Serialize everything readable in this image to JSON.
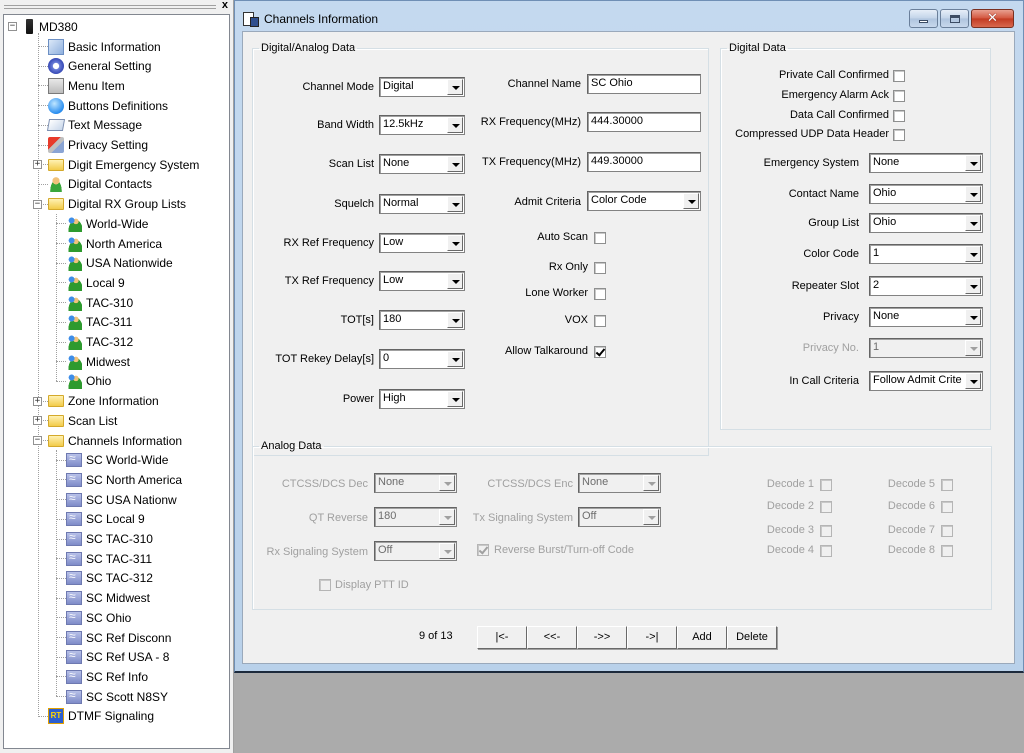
{
  "tree": {
    "close_label": "x",
    "root": {
      "label": "MD380",
      "icon": "radio-icon",
      "expanded": true
    },
    "items": [
      {
        "label": "Basic Information",
        "icon": "document-icon",
        "level": 1
      },
      {
        "label": "General Setting",
        "icon": "gear-icon",
        "level": 1
      },
      {
        "label": "Menu Item",
        "icon": "menu-icon",
        "level": 1
      },
      {
        "label": "Buttons Definitions",
        "icon": "button-icon",
        "level": 1
      },
      {
        "label": "Text Message",
        "icon": "message-icon",
        "level": 1
      },
      {
        "label": "Privacy Setting",
        "icon": "privacy-icon",
        "level": 1
      },
      {
        "label": "Digit Emergency System",
        "icon": "folder-icon",
        "level": 1,
        "expander": "+"
      },
      {
        "label": "Digital Contacts",
        "icon": "contact-icon",
        "level": 1
      },
      {
        "label": "Digital RX Group Lists",
        "icon": "folder-open-icon",
        "level": 1,
        "expander": "-"
      },
      {
        "label": "World-Wide",
        "icon": "group-icon",
        "level": 2
      },
      {
        "label": "North America",
        "icon": "group-icon",
        "level": 2
      },
      {
        "label": "USA Nationwide",
        "icon": "group-icon",
        "level": 2
      },
      {
        "label": "Local 9",
        "icon": "group-icon",
        "level": 2
      },
      {
        "label": "TAC-310",
        "icon": "group-icon",
        "level": 2
      },
      {
        "label": "TAC-311",
        "icon": "group-icon",
        "level": 2
      },
      {
        "label": "TAC-312",
        "icon": "group-icon",
        "level": 2
      },
      {
        "label": "Midwest",
        "icon": "group-icon",
        "level": 2
      },
      {
        "label": "Ohio",
        "icon": "group-icon",
        "level": 2
      },
      {
        "label": "Zone Information",
        "icon": "folder-icon",
        "level": 1,
        "expander": "+"
      },
      {
        "label": "Scan List",
        "icon": "folder-icon",
        "level": 1,
        "expander": "+"
      },
      {
        "label": "Channels Information",
        "icon": "folder-open-icon",
        "level": 1,
        "expander": "-"
      },
      {
        "label": "SC World-Wide",
        "icon": "channel-icon",
        "level": 2
      },
      {
        "label": "SC North America",
        "icon": "channel-icon",
        "level": 2
      },
      {
        "label": "SC USA Nationw",
        "icon": "channel-icon",
        "level": 2
      },
      {
        "label": "SC Local 9",
        "icon": "channel-icon",
        "level": 2
      },
      {
        "label": "SC TAC-310",
        "icon": "channel-icon",
        "level": 2
      },
      {
        "label": "SC TAC-311",
        "icon": "channel-icon",
        "level": 2
      },
      {
        "label": "SC TAC-312",
        "icon": "channel-icon",
        "level": 2
      },
      {
        "label": "SC Midwest",
        "icon": "channel-icon",
        "level": 2
      },
      {
        "label": "SC Ohio",
        "icon": "channel-icon",
        "level": 2
      },
      {
        "label": "SC Ref Disconn",
        "icon": "channel-icon",
        "level": 2
      },
      {
        "label": "SC Ref USA - 8",
        "icon": "channel-icon",
        "level": 2
      },
      {
        "label": "SC Ref Info",
        "icon": "channel-icon",
        "level": 2
      },
      {
        "label": "SC Scott N8SY",
        "icon": "channel-icon",
        "level": 2
      },
      {
        "label": "DTMF Signaling",
        "icon": "dtmf-icon",
        "level": 1
      }
    ]
  },
  "window": {
    "title": "Channels Information",
    "buttons": {
      "minimize": "minimize",
      "maximize": "maximize",
      "close": "close"
    }
  },
  "digital_analog": {
    "legend": "Digital/Analog Data",
    "left_fields": [
      {
        "label": "Channel Mode",
        "value": "Digital"
      },
      {
        "label": "Band Width",
        "value": "12.5kHz"
      },
      {
        "label": "Scan List",
        "value": "None"
      },
      {
        "label": "Squelch",
        "value": "Normal"
      },
      {
        "label": "RX Ref Frequency",
        "value": "Low"
      },
      {
        "label": "TX Ref Frequency",
        "value": "Low"
      },
      {
        "label": "TOT[s]",
        "value": "180"
      },
      {
        "label": "TOT Rekey Delay[s]",
        "value": "0"
      },
      {
        "label": "Power",
        "value": "High"
      }
    ],
    "channel_name": {
      "label": "Channel Name",
      "value": "SC Ohio"
    },
    "rx_freq": {
      "label": "RX Frequency(MHz)",
      "value": "444.30000"
    },
    "tx_freq": {
      "label": "TX Frequency(MHz)",
      "value": "449.30000"
    },
    "admit_criteria": {
      "label": "Admit Criteria",
      "value": "Color Code"
    },
    "checks": [
      {
        "label": "Auto Scan",
        "checked": false
      },
      {
        "label": "Rx Only",
        "checked": false
      },
      {
        "label": "Lone Worker",
        "checked": false
      },
      {
        "label": "VOX",
        "checked": false
      },
      {
        "label": "Allow Talkaround",
        "checked": true
      }
    ]
  },
  "digital": {
    "legend": "Digital Data",
    "checks": [
      {
        "label": "Private Call Confirmed",
        "checked": false
      },
      {
        "label": "Emergency Alarm Ack",
        "checked": false
      },
      {
        "label": "Data Call Confirmed",
        "checked": false
      },
      {
        "label": "Compressed UDP Data Header",
        "checked": false
      }
    ],
    "fields": [
      {
        "label": "Emergency System",
        "value": "None",
        "disabled": false
      },
      {
        "label": "Contact Name",
        "value": "Ohio",
        "disabled": false
      },
      {
        "label": "Group List",
        "value": "Ohio",
        "disabled": false
      },
      {
        "label": "Color Code",
        "value": "1",
        "disabled": false
      },
      {
        "label": "Repeater Slot",
        "value": "2",
        "disabled": false
      },
      {
        "label": "Privacy",
        "value": "None",
        "disabled": false
      },
      {
        "label": "Privacy No.",
        "value": "1",
        "disabled": true
      },
      {
        "label": "In Call Criteria",
        "value": "Follow Admit Criteria",
        "disabled": false
      }
    ]
  },
  "analog": {
    "legend": "Analog Data",
    "ctcss_dec": {
      "label": "CTCSS/DCS Dec",
      "value": "None"
    },
    "ctcss_enc": {
      "label": "CTCSS/DCS Enc",
      "value": "None"
    },
    "qt_reverse": {
      "label": "QT Reverse",
      "value": "180"
    },
    "tx_signaling": {
      "label": "Tx Signaling System",
      "value": "Off"
    },
    "rx_signaling": {
      "label": "Rx Signaling System",
      "value": "Off"
    },
    "reverse_burst": {
      "label": "Reverse Burst/Turn-off Code",
      "checked": true
    },
    "display_ptt": {
      "label": "Display PTT ID",
      "checked": false
    },
    "decodes": [
      {
        "label": "Decode 1",
        "checked": false
      },
      {
        "label": "Decode 2",
        "checked": false
      },
      {
        "label": "Decode 3",
        "checked": false
      },
      {
        "label": "Decode 4",
        "checked": false
      },
      {
        "label": "Decode 5",
        "checked": false
      },
      {
        "label": "Decode 6",
        "checked": false
      },
      {
        "label": "Decode 7",
        "checked": false
      },
      {
        "label": "Decode 8",
        "checked": false
      }
    ]
  },
  "navigation": {
    "counter": "9 of 13",
    "first": "|<-",
    "prev": "<<-",
    "next": "->>",
    "last": "->|",
    "add": "Add",
    "delete": "Delete"
  }
}
